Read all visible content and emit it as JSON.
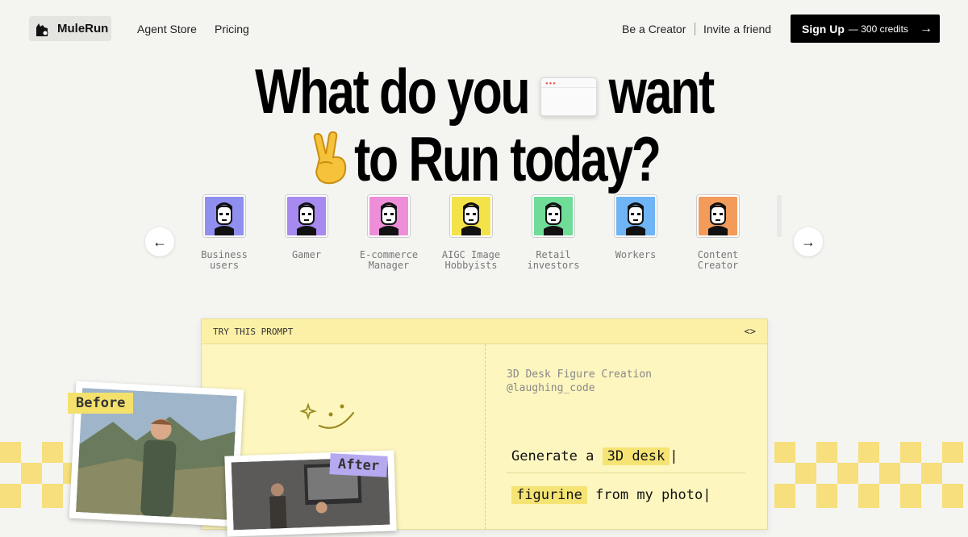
{
  "header": {
    "logo_text": "MuleRun",
    "nav": {
      "agent_store": "Agent Store",
      "pricing": "Pricing",
      "be_creator": "Be a Creator",
      "invite": "Invite a friend"
    },
    "signup": {
      "label": "Sign Up",
      "credits": "— 300 credits",
      "arrow": "→"
    }
  },
  "hero": {
    "line1_a": "What do you",
    "line1_b": "want",
    "line2": "to Run today?"
  },
  "carousel": {
    "prev": "←",
    "next": "→",
    "personas": [
      {
        "label": "Business\nusers",
        "color": "#8f8ff0"
      },
      {
        "label": "Gamer",
        "color": "#a78af0"
      },
      {
        "label": "E-commerce\nManager",
        "color": "#ef8ed8"
      },
      {
        "label": "AIGC Image\nHobbyists",
        "color": "#f3e24a"
      },
      {
        "label": "Retail\ninvestors",
        "color": "#6fdc98"
      },
      {
        "label": "Workers",
        "color": "#6fb4f4"
      },
      {
        "label": "Content\nCreator",
        "color": "#f39b5b"
      }
    ]
  },
  "prompt_card": {
    "header_label": "TRY THIS PROMPT",
    "code_icon": "<>",
    "title": "3D Desk Figure Creation",
    "author": "@laughing_code",
    "line1_prefix": "Generate a",
    "line1_highlight": "3D desk",
    "line2_highlight": "figurine",
    "line2_suffix": "from my photo"
  },
  "photos": {
    "before_tag": "Before",
    "after_tag": "After"
  },
  "colors": {
    "accent_yellow": "#f3e16c",
    "accent_purple": "#b6a9f0",
    "card_bg": "#fdf6bf"
  }
}
